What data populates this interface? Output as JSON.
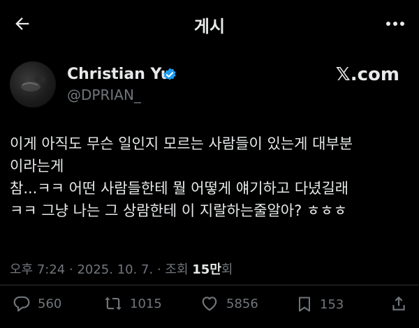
{
  "header": {
    "title": "게시",
    "back_icon": "back-arrow-icon",
    "more_icon": "more-horizontal-icon"
  },
  "author": {
    "display_name": "Christian Yu",
    "handle": "@DPRIAN_",
    "verified_icon": "verified-badge-icon",
    "verified_color": "#1d9bf0",
    "source_label": "𝕏.com"
  },
  "tweet": {
    "lines": [
      "이게 아직도 무슨 일인지 모르는 사람들이 있는게 대부분",
      "이라는게",
      "참...ㅋㅋ 어떤 사람들한테 뭘 어떻게 얘기하고 다녔길래",
      "ㅋㅋ 그냥 나는 그 상람한테 이 지랄하는줄알아? ㅎㅎㅎ"
    ]
  },
  "meta": {
    "time": "오후 7:24",
    "date": "2025. 10. 7.",
    "views_prefix": "조회",
    "views_count": "15만",
    "views_suffix": "회"
  },
  "actions": {
    "reply": {
      "icon": "reply-icon",
      "count": "560"
    },
    "retweet": {
      "icon": "retweet-icon",
      "count": "1015"
    },
    "like": {
      "icon": "heart-icon",
      "count": "5856"
    },
    "bookmark": {
      "icon": "bookmark-icon",
      "count": "153"
    },
    "share": {
      "icon": "share-icon"
    }
  },
  "colors": {
    "background": "#000000",
    "text_primary": "#e7e9ea",
    "text_secondary": "#71767b",
    "divider": "#2f3336"
  }
}
